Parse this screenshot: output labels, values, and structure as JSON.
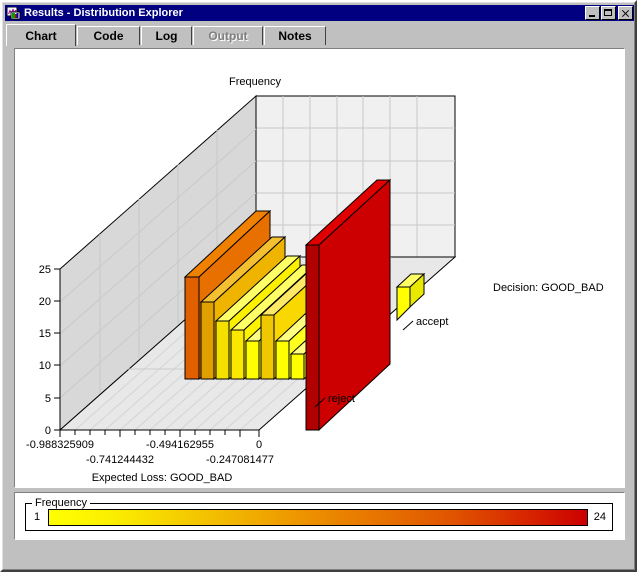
{
  "window": {
    "title": "Results - Distribution Explorer",
    "icon": "chart-document-icon",
    "buttons": {
      "minimize": "minimize-button",
      "maximize": "maximize-button",
      "close": "close-button"
    }
  },
  "tabs": [
    {
      "label": "Chart",
      "state": "active"
    },
    {
      "label": "Code",
      "state": "normal"
    },
    {
      "label": "Log",
      "state": "normal"
    },
    {
      "label": "Output",
      "state": "disabled"
    },
    {
      "label": "Notes",
      "state": "normal"
    }
  ],
  "legend": {
    "title": "Frequency",
    "min": "1",
    "max": "24",
    "gradient_start": "#ffff00",
    "gradient_end": "#cc0000"
  },
  "chart_data": {
    "type": "bar",
    "title": "",
    "zlabel": "Frequency",
    "xlabel": "Expected Loss: GOOD_BAD",
    "ylabel": "Decision: GOOD_BAD",
    "ylim": [
      0,
      27
    ],
    "ztick_labels": [
      "0",
      "5",
      "10",
      "15",
      "20",
      "25"
    ],
    "ztick_values": [
      0,
      5,
      10,
      15,
      20,
      25
    ],
    "xtick_labels": [
      "-0.988325909",
      "-0.741244432",
      "-0.494162955",
      "-0.247081477",
      "0"
    ],
    "xtick_values": [
      -0.988325909,
      -0.741244432,
      -0.494162955,
      -0.247081477,
      0
    ],
    "xlim": [
      -0.988325909,
      0
    ],
    "categories_y": [
      "reject",
      "accept"
    ],
    "grid": true,
    "legend_position": "bottom",
    "colorbar": {
      "min": 1,
      "max": 24
    },
    "series": [
      {
        "name": "reject",
        "values": [
          0,
          0,
          0,
          0,
          0,
          0,
          12,
          8,
          4,
          3,
          2,
          5,
          2,
          1,
          24
        ],
        "colors": [
          "#ffff00",
          "#ffff00",
          "#ffff00",
          "#ffff00",
          "#ffff00",
          "#ffff00",
          "#e07000",
          "#eca000",
          "#f7d800",
          "#fbe800",
          "#ffff00",
          "#f5c800",
          "#ffff00",
          "#ffff00",
          "#cc0000"
        ]
      },
      {
        "name": "accept",
        "values": [
          0,
          0,
          0,
          0,
          0,
          0,
          0,
          0,
          0,
          0,
          0,
          0,
          3,
          0,
          2
        ],
        "colors": [
          "#ffff00",
          "#ffff00",
          "#ffff00",
          "#ffff00",
          "#ffff00",
          "#ffff00",
          "#ffff00",
          "#ffff00",
          "#ffff00",
          "#ffff00",
          "#ffff00",
          "#ffff00",
          "#ffff00",
          "#ffff00",
          "#ffff00"
        ]
      }
    ]
  }
}
